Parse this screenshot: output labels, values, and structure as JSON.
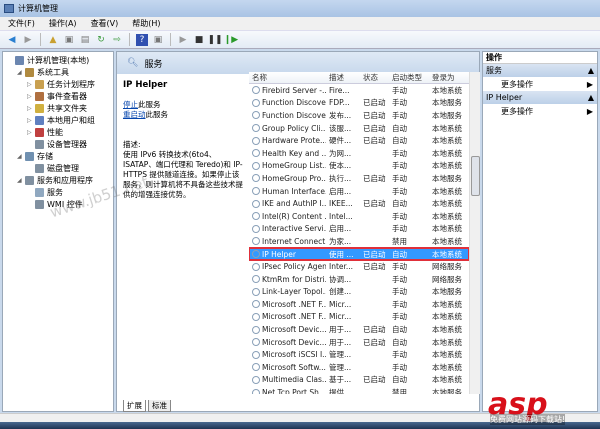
{
  "window": {
    "title": "计算机管理"
  },
  "menu": [
    "文件(F)",
    "操作(A)",
    "查看(V)",
    "帮助(H)"
  ],
  "tree": [
    {
      "label": "计算机管理(本地)",
      "level": 0,
      "exp": "",
      "color": "#6b86b0"
    },
    {
      "label": "系统工具",
      "level": 1,
      "exp": "◢",
      "color": "#b08a40"
    },
    {
      "label": "任务计划程序",
      "level": 2,
      "exp": "▷",
      "color": "#c9a050"
    },
    {
      "label": "事件查看器",
      "level": 2,
      "exp": "▷",
      "color": "#b07040"
    },
    {
      "label": "共享文件夹",
      "level": 2,
      "exp": "▷",
      "color": "#d0b040"
    },
    {
      "label": "本地用户和组",
      "level": 2,
      "exp": "▷",
      "color": "#6080c0"
    },
    {
      "label": "性能",
      "level": 2,
      "exp": "▷",
      "color": "#c04040"
    },
    {
      "label": "设备管理器",
      "level": 2,
      "exp": "",
      "color": "#8090a0"
    },
    {
      "label": "存储",
      "level": 1,
      "exp": "◢",
      "color": "#7090b0"
    },
    {
      "label": "磁盘管理",
      "level": 2,
      "exp": "",
      "color": "#8090a0"
    },
    {
      "label": "服务和应用程序",
      "level": 1,
      "exp": "◢",
      "color": "#8090a0"
    },
    {
      "label": "服务",
      "level": 2,
      "exp": "",
      "color": "#90a8c0"
    },
    {
      "label": "WMI 控件",
      "level": 2,
      "exp": "",
      "color": "#8090a0"
    }
  ],
  "panel": {
    "header": "服务"
  },
  "detail": {
    "title": "IP Helper",
    "stop_link": "停止",
    "stop_suffix": "此服务",
    "restart_link": "重启动",
    "restart_suffix": "此服务",
    "desc_label": "描述:",
    "desc": "使用 IPv6 转换技术(6to4、ISATAP、端口代理和 Teredo)和 IP-HTTPS 提供隧道连接。如果停止该服务，则计算机将不具备这些技术提供的增强连接优势。"
  },
  "columns": [
    "名称",
    "描述",
    "状态",
    "启动类型",
    "登录为"
  ],
  "services": [
    [
      "Firebird Server -...",
      "Fire...",
      "",
      "手动",
      "本地系统"
    ],
    [
      "Function Discove...",
      "FDP...",
      "已启动",
      "手动",
      "本地服务"
    ],
    [
      "Function Discove...",
      "发布...",
      "已启动",
      "手动",
      "本地服务"
    ],
    [
      "Group Policy Cli...",
      "该服...",
      "已启动",
      "自动",
      "本地系统"
    ],
    [
      "Hardware Prote...",
      "硬件...",
      "已启动",
      "自动",
      "本地系统"
    ],
    [
      "Health Key and ...",
      "为网...",
      "",
      "手动",
      "本地系统"
    ],
    [
      "HomeGroup List...",
      "使本...",
      "",
      "手动",
      "本地系统"
    ],
    [
      "HomeGroup Pro...",
      "执行...",
      "已启动",
      "手动",
      "本地服务"
    ],
    [
      "Human Interface...",
      "启用...",
      "",
      "手动",
      "本地系统"
    ],
    [
      "IKE and AuthIP I...",
      "IKEE...",
      "已启动",
      "自动",
      "本地系统"
    ],
    [
      "Intel(R) Content ...",
      "Intel...",
      "",
      "手动",
      "本地系统"
    ],
    [
      "Interactive Servi...",
      "启用...",
      "",
      "手动",
      "本地系统"
    ],
    [
      "Internet Connect...",
      "为家...",
      "",
      "禁用",
      "本地系统"
    ],
    [
      "IP Helper",
      "使用 ...",
      "已启动",
      "自动",
      "本地系统"
    ],
    [
      "IPsec Policy Agent",
      "Inter...",
      "已启动",
      "手动",
      "网络服务"
    ],
    [
      "KtmRm for Distri...",
      "协调...",
      "",
      "手动",
      "网络服务"
    ],
    [
      "Link-Layer Topol...",
      "创建...",
      "",
      "手动",
      "本地服务"
    ],
    [
      "Microsoft .NET F...",
      "Micr...",
      "",
      "手动",
      "本地系统"
    ],
    [
      "Microsoft .NET F...",
      "Micr...",
      "",
      "手动",
      "本地系统"
    ],
    [
      "Microsoft Devic...",
      "用于...",
      "已启动",
      "自动",
      "本地系统"
    ],
    [
      "Microsoft Devic...",
      "用于...",
      "已启动",
      "自动",
      "本地系统"
    ],
    [
      "Microsoft iSCSI I...",
      "管理...",
      "",
      "手动",
      "本地系统"
    ],
    [
      "Microsoft Softw...",
      "管理...",
      "",
      "手动",
      "本地系统"
    ],
    [
      "Multimedia Clas...",
      "基于...",
      "已启动",
      "自动",
      "本地系统"
    ],
    [
      "Net.Tcp Port Sh...",
      "提供...",
      "",
      "禁用",
      "本地服务"
    ]
  ],
  "selected_index": 13,
  "tabs": [
    "扩展",
    "标准"
  ],
  "actions": {
    "header": "操作",
    "sections": [
      {
        "title": "服务",
        "item": "更多操作"
      },
      {
        "title": "IP Helper",
        "item": "更多操作"
      }
    ]
  },
  "watermark": {
    "site": "www.jb51.net",
    "logo": "asp",
    "logo_sub": "免费网站源码下载站!"
  }
}
